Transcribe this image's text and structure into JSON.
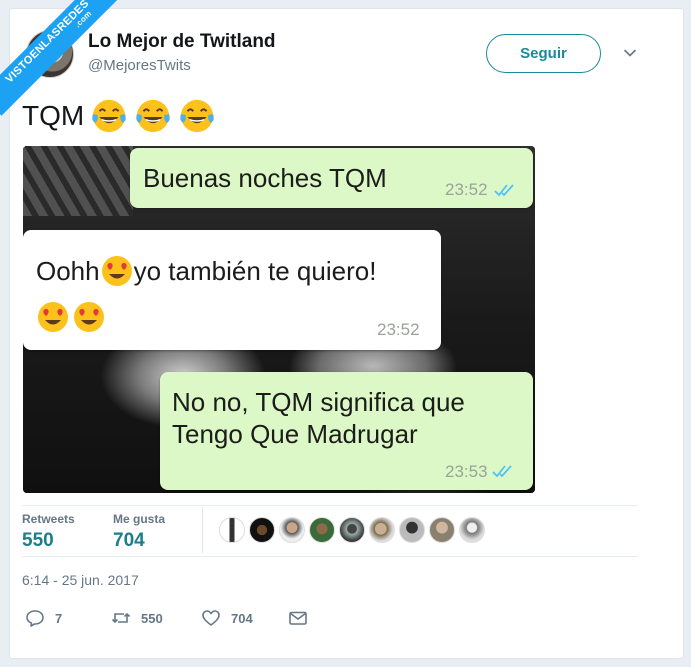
{
  "watermark": {
    "text": "VISTOENLASREDES",
    "suffix": ".com"
  },
  "header": {
    "display_name": "Lo Mejor de Twitland",
    "handle": "@MejoresTwits",
    "follow_label": "Seguir"
  },
  "tweet": {
    "text": "TQM",
    "emojis": [
      "face-with-tears-of-joy",
      "face-with-tears-of-joy",
      "face-with-tears-of-joy"
    ]
  },
  "chat": {
    "messages": [
      {
        "side": "outgoing",
        "text": "Buenas noches TQM",
        "time": "23:52",
        "read": true
      },
      {
        "side": "incoming",
        "text_before": "Oohh",
        "text_after": "yo también te quiero!",
        "emojis": [
          "smiling-face-with-heart-eyes",
          "smiling-face-with-heart-eyes",
          "smiling-face-with-heart-eyes"
        ],
        "time": "23:52"
      },
      {
        "side": "outgoing",
        "line1": "No no, TQM significa que",
        "line2": "Tengo Que Madrugar",
        "time": "23:53",
        "read": true
      }
    ]
  },
  "stats": {
    "retweets_label": "Retweets",
    "retweets_value": "550",
    "likes_label": "Me gusta",
    "likes_value": "704"
  },
  "timestamp": "6:14 - 25 jun. 2017",
  "actions": {
    "reply_count": "7",
    "retweet_count": "550",
    "like_count": "704"
  },
  "colors": {
    "accent": "#1a8a9a",
    "outgoing_bubble": "#dcf8c6",
    "read_ticks": "#4fc3f7",
    "watermark": "#1da1f2"
  }
}
